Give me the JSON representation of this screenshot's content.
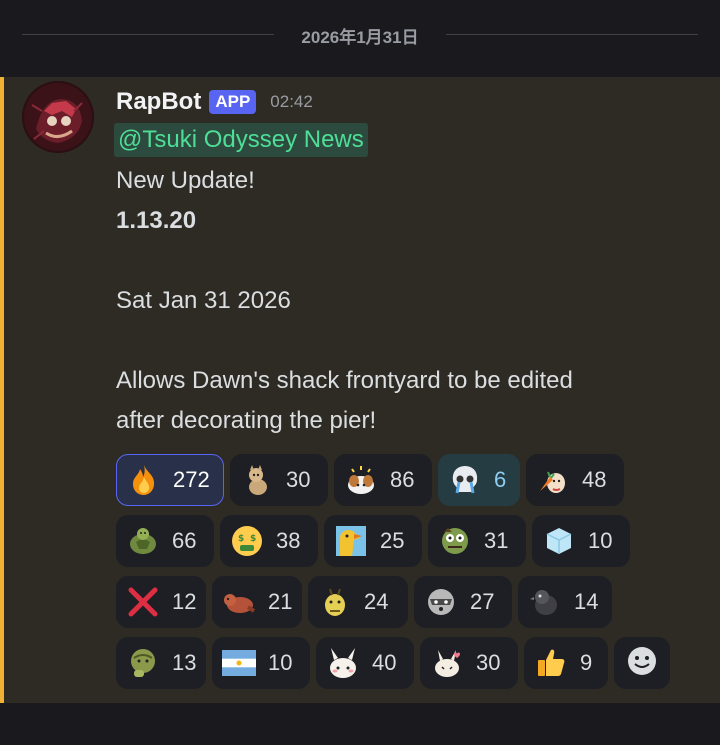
{
  "divider": {
    "date": "2026年1月31日"
  },
  "message": {
    "username": "RapBot",
    "badge": "APP",
    "time": "02:42",
    "mention": "@Tsuki Odyssey News",
    "lines": {
      "l1": "New Update!",
      "l2": "1.13.20",
      "l3": "Sat Jan 31 2026",
      "l4": "Allows Dawn's shack frontyard to be edited",
      "l5": "after decorating the pier!"
    }
  },
  "colors": {
    "accent_bar": "#f0b232",
    "brand": "#5865f2",
    "mention_text": "#4ede97"
  },
  "reactions": [
    {
      "icon": "fire-emoji",
      "count": "272",
      "active": true
    },
    {
      "icon": "sitting-cat-emoji",
      "count": "30"
    },
    {
      "icon": "dizzy-dog-emoji",
      "count": "86"
    },
    {
      "icon": "crying-skull-emoji",
      "count": "6",
      "highlight": true
    },
    {
      "icon": "cow-carrot-emoji",
      "count": "48"
    },
    {
      "icon": "turtle-emoji",
      "count": "66"
    },
    {
      "icon": "money-mouth-emoji",
      "count": "38"
    },
    {
      "icon": "screaming-bird-emoji",
      "count": "25"
    },
    {
      "icon": "zombie-turtle-emoji",
      "count": "31"
    },
    {
      "icon": "ice-cube-emoji",
      "count": "10"
    },
    {
      "icon": "red-x-emoji",
      "count": "12"
    },
    {
      "icon": "beaver-emoji",
      "count": "21"
    },
    {
      "icon": "yellow-bee-emoji",
      "count": "24"
    },
    {
      "icon": "raccoon-emoji",
      "count": "27"
    },
    {
      "icon": "dark-crow-emoji",
      "count": "14"
    },
    {
      "icon": "thinking-turtle-emoji",
      "count": "13"
    },
    {
      "icon": "argentina-flag-emoji",
      "count": "10"
    },
    {
      "icon": "bunny-blush-emoji",
      "count": "40"
    },
    {
      "icon": "bunny-heart-emoji",
      "count": "30"
    },
    {
      "icon": "thumbs-up-emoji",
      "count": "9"
    }
  ]
}
